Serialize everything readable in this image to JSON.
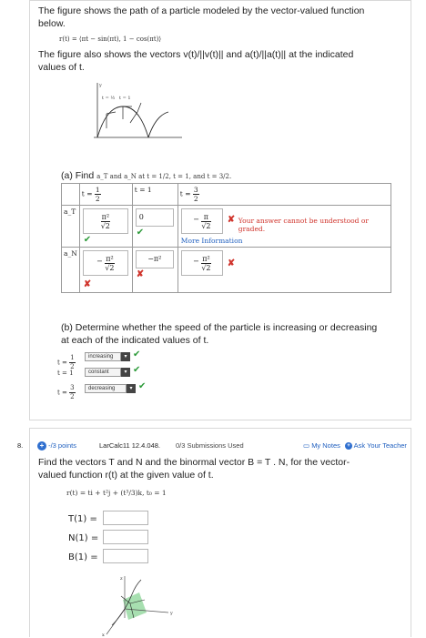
{
  "top": {
    "intro_line1": "The figure shows the path of a particle modeled by the vector-valued function",
    "intro_line2": "below.",
    "formula": "r(t) = ⟨πt − sin(πt), 1 − cos(πt)⟩",
    "para2_line1": "The figure also shows the vectors v(t)/||v(t)|| and a(t)/||a(t)|| at the indicated",
    "para2_line2": "values of t.",
    "figure_labels": {
      "y": "y",
      "t_half": "t = ½",
      "t_one": "t = 1"
    },
    "part_a": {
      "prefix": "(a) Find",
      "prompt": "a_T and a_N at t = 1/2, t = 1, and t = 3/2.",
      "headers": {
        "t1": "t =",
        "t1_num": "1",
        "t1_den": "2",
        "t2": "t = 1",
        "t3": "t =",
        "t3_num": "3",
        "t3_den": "2"
      },
      "row_aT": {
        "label": "a_T",
        "c1": {
          "num": "π²",
          "den": "√2",
          "status": "correct"
        },
        "c2": {
          "value": "0",
          "status": "correct"
        },
        "c3": {
          "num": "π",
          "den": "√2",
          "sign": "−",
          "status": "incorrect"
        },
        "feedback": "Your answer cannot be understood or graded.",
        "more_info": "More Information"
      },
      "row_aN": {
        "label": "a_N",
        "c1": {
          "num": "π²",
          "den": "√2",
          "sign": "−",
          "status": "incorrect"
        },
        "c2": {
          "value": "−π²",
          "status": "incorrect"
        },
        "c3": {
          "num": "π²",
          "den": "√2",
          "sign": "−",
          "status": "incorrect"
        }
      }
    },
    "part_b": {
      "line1": "(b) Determine whether the speed of the particle is increasing or decreasing",
      "line2": "at each of the indicated values of t.",
      "rows": [
        {
          "t": "t =",
          "num": "1",
          "den": "2",
          "value": "increasing"
        },
        {
          "t": "t = 1",
          "value": "constant"
        },
        {
          "t": "t =",
          "num": "3",
          "den": "2",
          "value": "decreasing"
        }
      ]
    }
  },
  "q8": {
    "number": "8.",
    "points": "-/3 points",
    "source": "LarCalc11 12.4.048.",
    "submissions": "0/3 Submissions Used",
    "my_notes": "My Notes",
    "ask_teacher": "Ask Your Teacher",
    "line1": "Find the vectors T and N and the binormal vector B = T . N, for the vector-",
    "line2": "valued function r(t) at the given value of t.",
    "formula": "r(t) = ti + t²j + (t³/3)k,    t₀ = 1",
    "fields": [
      {
        "label": "T(1) =",
        "value": ""
      },
      {
        "label": "N(1) =",
        "value": ""
      },
      {
        "label": "B(1) =",
        "value": ""
      }
    ],
    "axis_labels": {
      "z": "z",
      "y": "y",
      "x": "x"
    }
  },
  "colors": {
    "correct": "#2d9b3a",
    "incorrect": "#d0342c",
    "link": "#1f5fbf",
    "badge": "#2f6fcf"
  }
}
